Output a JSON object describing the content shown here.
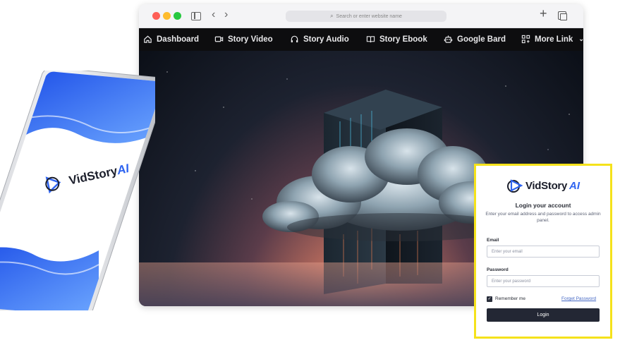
{
  "browser": {
    "url_placeholder": "Search or enter website name"
  },
  "navbar": {
    "items": [
      {
        "label": "Dashboard",
        "icon": "home-icon"
      },
      {
        "label": "Story Video",
        "icon": "video-icon"
      },
      {
        "label": "Story Audio",
        "icon": "headphones-icon"
      },
      {
        "label": "Story Ebook",
        "icon": "book-icon"
      },
      {
        "label": "Google Bard",
        "icon": "robot-icon"
      },
      {
        "label": "More Link",
        "icon": "grid-icon"
      }
    ]
  },
  "phone": {
    "brand": "VidStory",
    "brand_ai": "AI"
  },
  "login": {
    "brand": "VidStory",
    "brand_ai": "AI",
    "title": "Login your account",
    "subtitle": "Enter your email address and password to access admin panel.",
    "email_label": "Email",
    "email_placeholder": "Enter your email",
    "password_label": "Password",
    "password_placeholder": "Enter your password",
    "remember_label": "Remember me",
    "remember_checked": true,
    "forget_label": "Forget Password",
    "button_label": "Login"
  },
  "colors": {
    "accent": "#2f64f0",
    "highlight_border": "#f5e21b",
    "navbar_bg": "#0d0d0f",
    "button_bg": "#232734"
  }
}
